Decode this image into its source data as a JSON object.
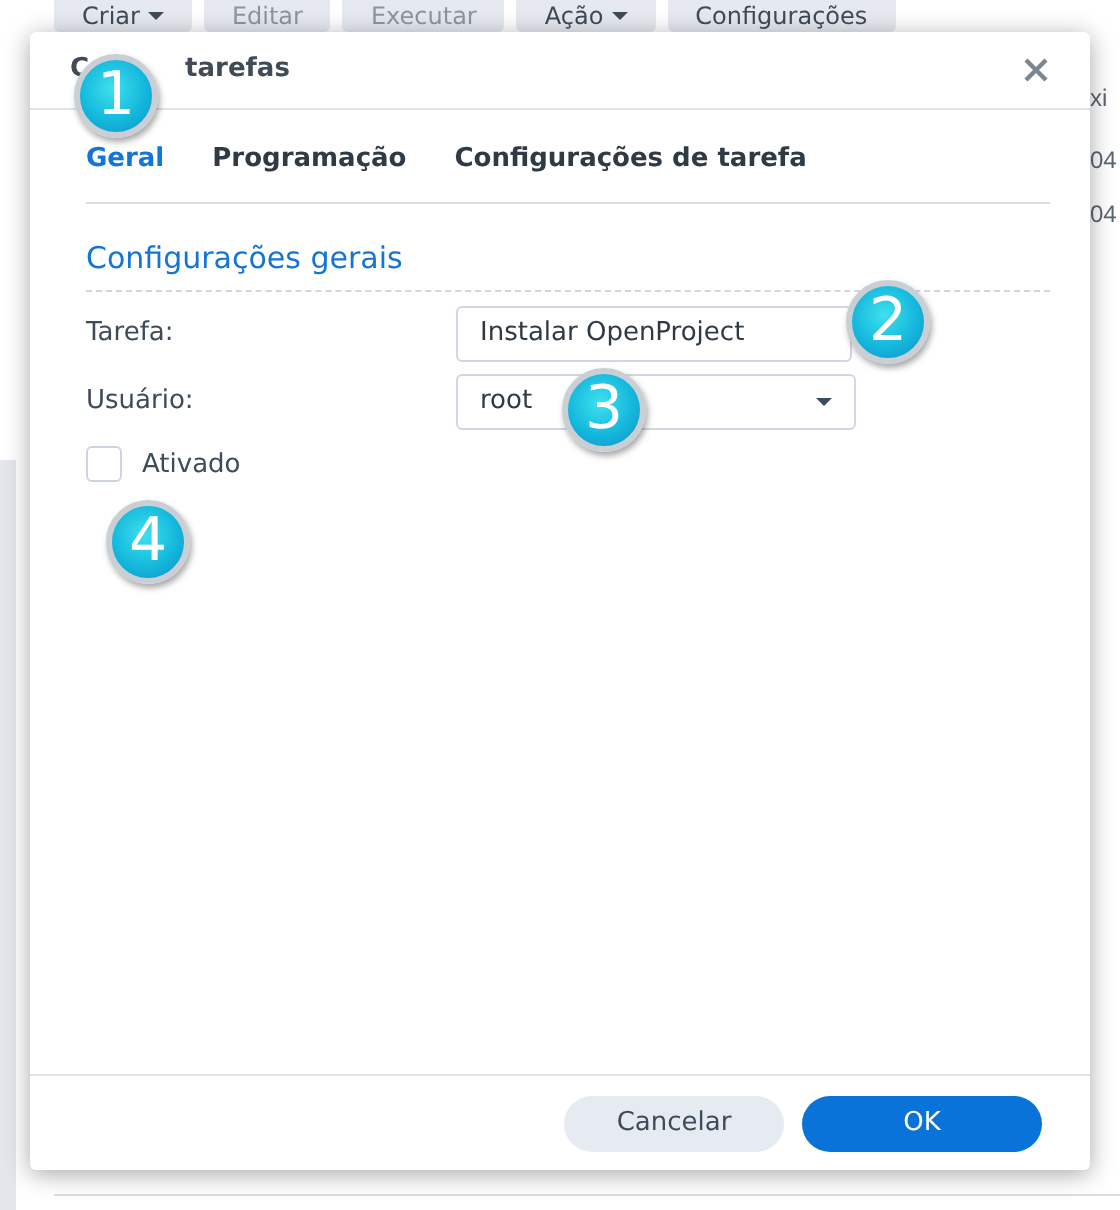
{
  "background": {
    "toolbar": [
      {
        "label": "Criar",
        "disabled": false,
        "caret": true
      },
      {
        "label": "Editar",
        "disabled": true,
        "caret": false
      },
      {
        "label": "Executar",
        "disabled": true,
        "caret": false
      },
      {
        "label": "Ação",
        "disabled": false,
        "caret": true
      },
      {
        "label": "Configurações",
        "disabled": false,
        "caret": false
      }
    ],
    "column_header": "xi",
    "cells": [
      "04",
      "04"
    ]
  },
  "dialog": {
    "title_parts": [
      "C",
      "tarefas"
    ],
    "tabs": [
      {
        "label": "Geral",
        "selected": true
      },
      {
        "label": "Programação",
        "selected": false
      },
      {
        "label": "Configurações de tarefa",
        "selected": false
      }
    ],
    "section_title": "Configurações gerais",
    "fields": [
      {
        "kind": "text",
        "label": "Tarefa:",
        "value": "Instalar OpenProject"
      },
      {
        "kind": "select",
        "label": "Usuário:",
        "value": "root"
      }
    ],
    "checkbox": {
      "label": "Ativado",
      "checked": false
    },
    "buttons": [
      {
        "label": "Cancelar",
        "kind": "secondary"
      },
      {
        "label": "OK",
        "kind": "primary"
      }
    ]
  },
  "callouts": [
    "1",
    "2",
    "3",
    "4"
  ]
}
